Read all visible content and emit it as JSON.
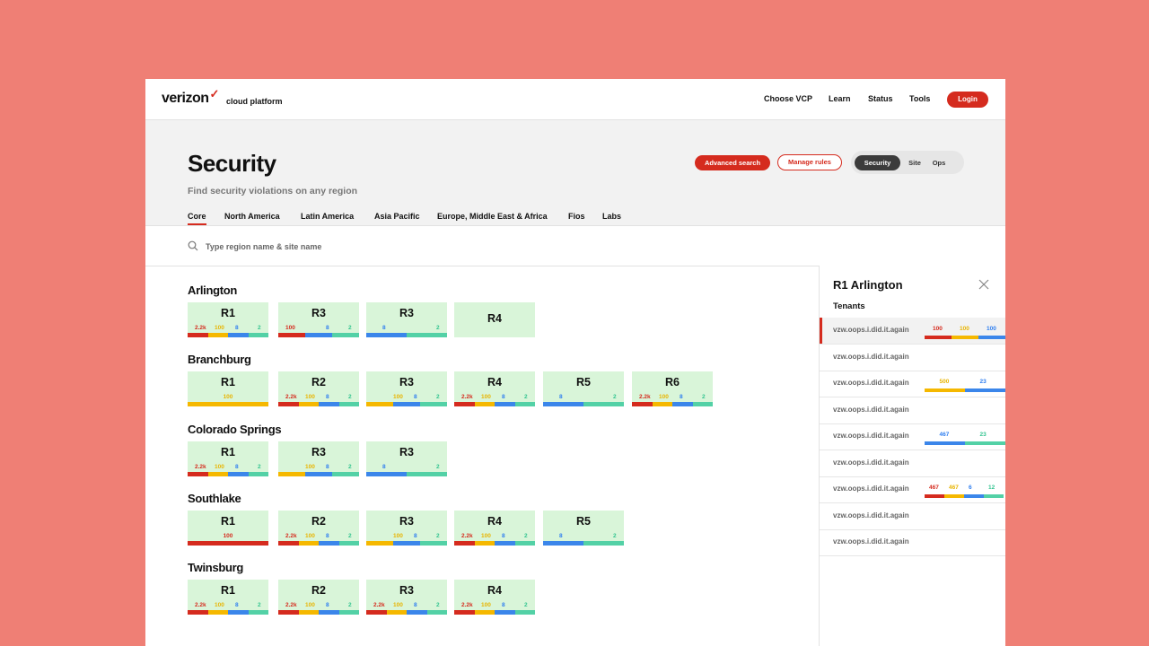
{
  "nav": {
    "brand": "verizon",
    "brand_check": "✓",
    "brand_sub": "cloud platform",
    "links": [
      "Choose VCP",
      "Learn",
      "Status",
      "Tools"
    ],
    "login": "Login"
  },
  "header": {
    "title": "Security",
    "subtitle": "Find security violations on any region",
    "advanced_search": "Advanced search",
    "manage_rules": "Manage rules",
    "segments": [
      "Security",
      "Site",
      "Ops"
    ],
    "active_segment": "Security",
    "tabs": [
      "Core",
      "North America",
      "Latin America",
      "Asia Pacific",
      "Europe, Middle East & Africa",
      "Fios",
      "Labs"
    ],
    "active_tab": "Core"
  },
  "search": {
    "placeholder": "Type region name & site name"
  },
  "sites": [
    {
      "name": "Arlington",
      "regions": [
        {
          "label": "R1",
          "red": "2.2k",
          "yellow": "100",
          "blue": "8",
          "green": "2"
        },
        {
          "label": "R3",
          "red": "100",
          "blue": "8",
          "green": "2"
        },
        {
          "label": "R3",
          "blue": "8",
          "green": "2"
        },
        {
          "label": "R4"
        }
      ]
    },
    {
      "name": "Branchburg",
      "regions": [
        {
          "label": "R1",
          "yellow": "100"
        },
        {
          "label": "R2",
          "red": "2.2k",
          "yellow": "100",
          "blue": "8",
          "green": "2"
        },
        {
          "label": "R3",
          "yellow": "100",
          "blue": "8",
          "green": "2"
        },
        {
          "label": "R4",
          "red": "2.2k",
          "yellow": "100",
          "blue": "8",
          "green": "2"
        },
        {
          "label": "R5",
          "blue": "8",
          "green": "2"
        },
        {
          "label": "R6",
          "red": "2.2k",
          "yellow": "100",
          "blue": "8",
          "green": "2"
        }
      ]
    },
    {
      "name": "Colorado Springs",
      "regions": [
        {
          "label": "R1",
          "red": "2.2k",
          "yellow": "100",
          "blue": "8",
          "green": "2"
        },
        {
          "label": "R3",
          "yellow": "100",
          "blue": "8",
          "green": "2"
        },
        {
          "label": "R3",
          "blue": "8",
          "green": "2"
        }
      ]
    },
    {
      "name": "Southlake",
      "regions": [
        {
          "label": "R1",
          "red": "100"
        },
        {
          "label": "R2",
          "red": "2.2k",
          "yellow": "100",
          "blue": "8",
          "green": "2"
        },
        {
          "label": "R3",
          "yellow": "100",
          "blue": "8",
          "green": "2"
        },
        {
          "label": "R4",
          "red": "2.2k",
          "yellow": "100",
          "blue": "8",
          "green": "2"
        },
        {
          "label": "R5",
          "blue": "8",
          "green": "2"
        }
      ]
    },
    {
      "name": "Twinsburg",
      "regions": [
        {
          "label": "R1",
          "red": "2.2k",
          "yellow": "100",
          "blue": "8",
          "green": "2"
        },
        {
          "label": "R2",
          "red": "2.2k",
          "yellow": "100",
          "blue": "8",
          "green": "2"
        },
        {
          "label": "R3",
          "red": "2.2k",
          "yellow": "100",
          "blue": "8",
          "green": "2"
        },
        {
          "label": "R4",
          "red": "2.2k",
          "yellow": "100",
          "blue": "8",
          "green": "2"
        }
      ]
    }
  ],
  "panel": {
    "title": "R1 Arlington",
    "subtitle": "Tenants",
    "tenants": [
      {
        "name": "vzw.oops.i.did.it.again",
        "selected": true,
        "red": "100",
        "yellow": "100",
        "blue": "100"
      },
      {
        "name": "vzw.oops.i.did.it.again"
      },
      {
        "name": "vzw.oops.i.did.it.again",
        "yellow": "500",
        "blue": "23"
      },
      {
        "name": "vzw.oops.i.did.it.again"
      },
      {
        "name": "vzw.oops.i.did.it.again",
        "blue": "467",
        "green": "23"
      },
      {
        "name": "vzw.oops.i.did.it.again"
      },
      {
        "name": "vzw.oops.i.did.it.again",
        "red": "467",
        "yellow": "467",
        "blue": "6",
        "green": "12"
      },
      {
        "name": "vzw.oops.i.did.it.again"
      },
      {
        "name": "vzw.oops.i.did.it.again"
      }
    ]
  },
  "colors": {
    "brand_red": "#d52b1e",
    "warn_yellow": "#f5b800",
    "info_blue": "#3b86ea",
    "ok_green": "#53d1a6",
    "card_bg": "#d9f5d9",
    "page_bg": "#ef7f75"
  }
}
